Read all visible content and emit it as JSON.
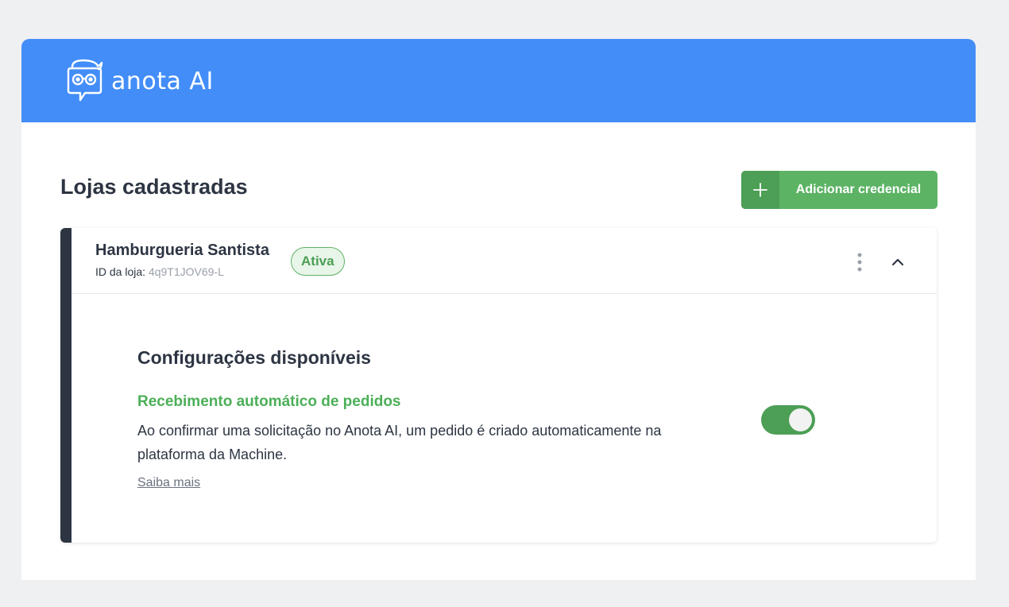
{
  "header": {
    "logo_text": "anota AI",
    "logo_icon": "owl-glasses-chat-icon",
    "brand_color": "#438df8"
  },
  "page": {
    "title": "Lojas cadastradas",
    "add_button_label": "Adicionar credencial",
    "add_button_icon": "plus-icon"
  },
  "store": {
    "name": "Hamburgueria Santista",
    "id_label": "ID da loja:",
    "id_value": "4q9T1JOV69-L",
    "status": "Ativa",
    "menu_icon": "kebab-icon",
    "collapse_icon": "chevron-up-icon"
  },
  "settings": {
    "section_title": "Configurações disponíveis",
    "items": [
      {
        "title": "Recebimento automático de pedidos",
        "description": "Ao confirmar uma solicitação no Anota AI, um pedido é criado automaticamente na plataforma da Machine.",
        "enabled": true,
        "link": "Saiba mais"
      }
    ]
  },
  "colors": {
    "accent_green": "#5cb364",
    "dark": "#2d3543"
  }
}
